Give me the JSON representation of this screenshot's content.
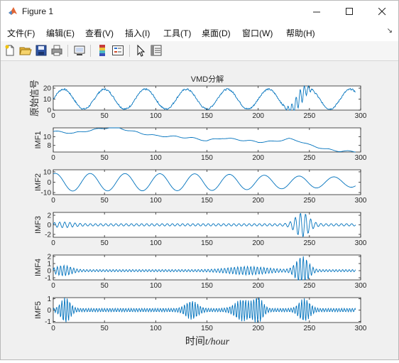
{
  "window": {
    "title": "Figure 1"
  },
  "menu": [
    "文件(F)",
    "编辑(E)",
    "查看(V)",
    "插入(I)",
    "工具(T)",
    "桌面(D)",
    "窗口(W)",
    "帮助(H)"
  ],
  "toolbar_icons": [
    "new-figure-icon",
    "open-file-icon",
    "save-icon",
    "print-icon",
    "link-plot-icon",
    "insert-colorbar-icon",
    "insert-legend-icon",
    "pointer-icon",
    "property-inspector-icon"
  ],
  "figure": {
    "title": "VMD分解",
    "xlabel_prefix": "时间",
    "xlabel_var": "t/hour"
  },
  "chart_data": [
    {
      "type": "line",
      "ylabel": "原始信号",
      "xlim": [
        0,
        300
      ],
      "ylim": [
        0,
        22
      ],
      "yticks": [
        0,
        10,
        20
      ],
      "xticks": [
        0,
        50,
        100,
        150,
        200,
        250,
        300
      ],
      "series": [
        {
          "baseline": 10,
          "components": [
            {
              "amp": 9,
              "period": 40,
              "phase": 0
            }
          ],
          "bursts": [
            {
              "center": 240,
              "width": 10,
              "amp": 7
            }
          ],
          "noise": 1.5
        }
      ]
    },
    {
      "type": "line",
      "ylabel": "IMF1",
      "xlim": [
        0,
        300
      ],
      "ylim": [
        6.5,
        12
      ],
      "yticks": [
        8,
        10
      ],
      "xticks": [
        0,
        50,
        100,
        150,
        200,
        250,
        300
      ],
      "series": [
        {
          "trend": [
            [
              0,
              11.2
            ],
            [
              10,
              11.0
            ],
            [
              20,
              10.8
            ],
            [
              40,
              11.6
            ],
            [
              55,
              12.1
            ],
            [
              65,
              11.9
            ],
            [
              85,
              10.8
            ],
            [
              100,
              10.2
            ],
            [
              120,
              10.0
            ],
            [
              135,
              9.7
            ],
            [
              150,
              9.1
            ],
            [
              165,
              9.7
            ],
            [
              185,
              9.2
            ],
            [
              200,
              8.8
            ],
            [
              215,
              8.9
            ],
            [
              230,
              9.5
            ],
            [
              240,
              9.0
            ],
            [
              250,
              8.1
            ],
            [
              265,
              7.2
            ],
            [
              280,
              6.7
            ],
            [
              295,
              6.6
            ]
          ]
        }
      ]
    },
    {
      "type": "line",
      "ylabel": "IMF2",
      "xlim": [
        0,
        300
      ],
      "ylim": [
        -12,
        12
      ],
      "yticks": [
        -10,
        0,
        10
      ],
      "xticks": [
        0,
        50,
        100,
        150,
        200,
        250,
        300
      ],
      "series": [
        {
          "components": [
            {
              "amp": 9.5,
              "period": 34,
              "phase": 1.2
            }
          ],
          "envelope": [
            [
              0,
              0.9
            ],
            [
              150,
              0.85
            ],
            [
              270,
              0.55
            ],
            [
              295,
              0.5
            ]
          ]
        }
      ]
    },
    {
      "type": "line",
      "ylabel": "IMF3",
      "xlim": [
        0,
        300
      ],
      "ylim": [
        -2.6,
        2.6
      ],
      "yticks": [
        -2,
        0,
        2
      ],
      "xticks": [
        0,
        50,
        100,
        150,
        200,
        250,
        300
      ],
      "series": [
        {
          "components": [
            {
              "amp": 0.25,
              "period": 5,
              "phase": 0
            }
          ],
          "bursts": [
            {
              "center": 243,
              "width": 9,
              "amp": 2.3
            },
            {
              "center": 10,
              "width": 12,
              "amp": 0.35
            }
          ],
          "carrier_period": 5
        }
      ]
    },
    {
      "type": "line",
      "ylabel": "IMF4",
      "xlim": [
        0,
        300
      ],
      "ylim": [
        -1.3,
        2.2
      ],
      "yticks": [
        -1,
        0,
        1,
        2
      ],
      "xticks": [
        0,
        50,
        100,
        150,
        200,
        250,
        300
      ],
      "series": [
        {
          "components": [
            {
              "amp": 0.15,
              "period": 3.2,
              "phase": 0
            }
          ],
          "bursts": [
            {
              "center": 243,
              "width": 8,
              "amp": 1.9
            },
            {
              "center": 10,
              "width": 10,
              "amp": 0.6
            },
            {
              "center": 190,
              "width": 25,
              "amp": 0.45
            }
          ],
          "carrier_period": 3.2
        }
      ]
    },
    {
      "type": "line",
      "ylabel": "IMF5",
      "xlim": [
        0,
        300
      ],
      "ylim": [
        -1.1,
        1.1
      ],
      "yticks": [
        -1,
        0,
        1
      ],
      "xticks": [
        0,
        50,
        100,
        150,
        200,
        250,
        300
      ],
      "series": [
        {
          "components": [
            {
              "amp": 0.15,
              "period": 2.6,
              "phase": 0
            }
          ],
          "bursts": [
            {
              "center": 12,
              "width": 6,
              "amp": 1.0
            },
            {
              "center": 135,
              "width": 8,
              "amp": 0.7
            },
            {
              "center": 185,
              "width": 10,
              "amp": 0.85
            },
            {
              "center": 200,
              "width": 6,
              "amp": 1.0
            },
            {
              "center": 245,
              "width": 7,
              "amp": 0.9
            }
          ],
          "carrier_period": 2.6
        }
      ]
    }
  ],
  "colors": {
    "line": "#0072bd",
    "axes_bg": "#ffffff",
    "figure_bg": "#f0f0f0",
    "axis": "#262626"
  }
}
